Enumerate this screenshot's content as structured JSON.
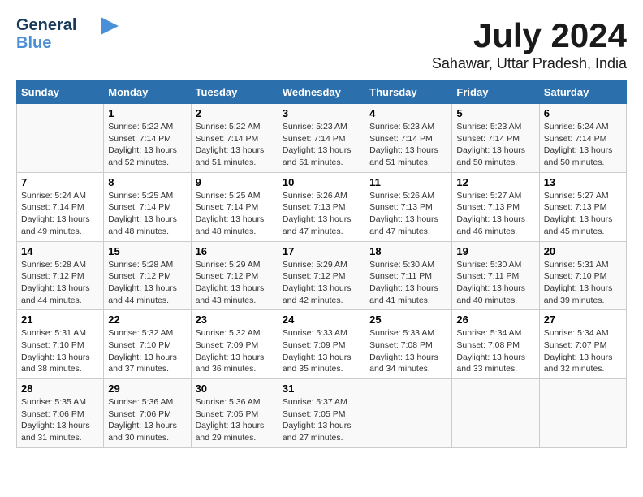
{
  "header": {
    "logo_line1": "General",
    "logo_line2": "Blue",
    "month": "July 2024",
    "location": "Sahawar, Uttar Pradesh, India"
  },
  "days_of_week": [
    "Sunday",
    "Monday",
    "Tuesday",
    "Wednesday",
    "Thursday",
    "Friday",
    "Saturday"
  ],
  "weeks": [
    [
      {
        "day": "",
        "sunrise": "",
        "sunset": "",
        "daylight": ""
      },
      {
        "day": "1",
        "sunrise": "Sunrise: 5:22 AM",
        "sunset": "Sunset: 7:14 PM",
        "daylight": "Daylight: 13 hours and 52 minutes."
      },
      {
        "day": "2",
        "sunrise": "Sunrise: 5:22 AM",
        "sunset": "Sunset: 7:14 PM",
        "daylight": "Daylight: 13 hours and 51 minutes."
      },
      {
        "day": "3",
        "sunrise": "Sunrise: 5:23 AM",
        "sunset": "Sunset: 7:14 PM",
        "daylight": "Daylight: 13 hours and 51 minutes."
      },
      {
        "day": "4",
        "sunrise": "Sunrise: 5:23 AM",
        "sunset": "Sunset: 7:14 PM",
        "daylight": "Daylight: 13 hours and 51 minutes."
      },
      {
        "day": "5",
        "sunrise": "Sunrise: 5:23 AM",
        "sunset": "Sunset: 7:14 PM",
        "daylight": "Daylight: 13 hours and 50 minutes."
      },
      {
        "day": "6",
        "sunrise": "Sunrise: 5:24 AM",
        "sunset": "Sunset: 7:14 PM",
        "daylight": "Daylight: 13 hours and 50 minutes."
      }
    ],
    [
      {
        "day": "7",
        "sunrise": "Sunrise: 5:24 AM",
        "sunset": "Sunset: 7:14 PM",
        "daylight": "Daylight: 13 hours and 49 minutes."
      },
      {
        "day": "8",
        "sunrise": "Sunrise: 5:25 AM",
        "sunset": "Sunset: 7:14 PM",
        "daylight": "Daylight: 13 hours and 48 minutes."
      },
      {
        "day": "9",
        "sunrise": "Sunrise: 5:25 AM",
        "sunset": "Sunset: 7:14 PM",
        "daylight": "Daylight: 13 hours and 48 minutes."
      },
      {
        "day": "10",
        "sunrise": "Sunrise: 5:26 AM",
        "sunset": "Sunset: 7:13 PM",
        "daylight": "Daylight: 13 hours and 47 minutes."
      },
      {
        "day": "11",
        "sunrise": "Sunrise: 5:26 AM",
        "sunset": "Sunset: 7:13 PM",
        "daylight": "Daylight: 13 hours and 47 minutes."
      },
      {
        "day": "12",
        "sunrise": "Sunrise: 5:27 AM",
        "sunset": "Sunset: 7:13 PM",
        "daylight": "Daylight: 13 hours and 46 minutes."
      },
      {
        "day": "13",
        "sunrise": "Sunrise: 5:27 AM",
        "sunset": "Sunset: 7:13 PM",
        "daylight": "Daylight: 13 hours and 45 minutes."
      }
    ],
    [
      {
        "day": "14",
        "sunrise": "Sunrise: 5:28 AM",
        "sunset": "Sunset: 7:12 PM",
        "daylight": "Daylight: 13 hours and 44 minutes."
      },
      {
        "day": "15",
        "sunrise": "Sunrise: 5:28 AM",
        "sunset": "Sunset: 7:12 PM",
        "daylight": "Daylight: 13 hours and 44 minutes."
      },
      {
        "day": "16",
        "sunrise": "Sunrise: 5:29 AM",
        "sunset": "Sunset: 7:12 PM",
        "daylight": "Daylight: 13 hours and 43 minutes."
      },
      {
        "day": "17",
        "sunrise": "Sunrise: 5:29 AM",
        "sunset": "Sunset: 7:12 PM",
        "daylight": "Daylight: 13 hours and 42 minutes."
      },
      {
        "day": "18",
        "sunrise": "Sunrise: 5:30 AM",
        "sunset": "Sunset: 7:11 PM",
        "daylight": "Daylight: 13 hours and 41 minutes."
      },
      {
        "day": "19",
        "sunrise": "Sunrise: 5:30 AM",
        "sunset": "Sunset: 7:11 PM",
        "daylight": "Daylight: 13 hours and 40 minutes."
      },
      {
        "day": "20",
        "sunrise": "Sunrise: 5:31 AM",
        "sunset": "Sunset: 7:10 PM",
        "daylight": "Daylight: 13 hours and 39 minutes."
      }
    ],
    [
      {
        "day": "21",
        "sunrise": "Sunrise: 5:31 AM",
        "sunset": "Sunset: 7:10 PM",
        "daylight": "Daylight: 13 hours and 38 minutes."
      },
      {
        "day": "22",
        "sunrise": "Sunrise: 5:32 AM",
        "sunset": "Sunset: 7:10 PM",
        "daylight": "Daylight: 13 hours and 37 minutes."
      },
      {
        "day": "23",
        "sunrise": "Sunrise: 5:32 AM",
        "sunset": "Sunset: 7:09 PM",
        "daylight": "Daylight: 13 hours and 36 minutes."
      },
      {
        "day": "24",
        "sunrise": "Sunrise: 5:33 AM",
        "sunset": "Sunset: 7:09 PM",
        "daylight": "Daylight: 13 hours and 35 minutes."
      },
      {
        "day": "25",
        "sunrise": "Sunrise: 5:33 AM",
        "sunset": "Sunset: 7:08 PM",
        "daylight": "Daylight: 13 hours and 34 minutes."
      },
      {
        "day": "26",
        "sunrise": "Sunrise: 5:34 AM",
        "sunset": "Sunset: 7:08 PM",
        "daylight": "Daylight: 13 hours and 33 minutes."
      },
      {
        "day": "27",
        "sunrise": "Sunrise: 5:34 AM",
        "sunset": "Sunset: 7:07 PM",
        "daylight": "Daylight: 13 hours and 32 minutes."
      }
    ],
    [
      {
        "day": "28",
        "sunrise": "Sunrise: 5:35 AM",
        "sunset": "Sunset: 7:06 PM",
        "daylight": "Daylight: 13 hours and 31 minutes."
      },
      {
        "day": "29",
        "sunrise": "Sunrise: 5:36 AM",
        "sunset": "Sunset: 7:06 PM",
        "daylight": "Daylight: 13 hours and 30 minutes."
      },
      {
        "day": "30",
        "sunrise": "Sunrise: 5:36 AM",
        "sunset": "Sunset: 7:05 PM",
        "daylight": "Daylight: 13 hours and 29 minutes."
      },
      {
        "day": "31",
        "sunrise": "Sunrise: 5:37 AM",
        "sunset": "Sunset: 7:05 PM",
        "daylight": "Daylight: 13 hours and 27 minutes."
      },
      {
        "day": "",
        "sunrise": "",
        "sunset": "",
        "daylight": ""
      },
      {
        "day": "",
        "sunrise": "",
        "sunset": "",
        "daylight": ""
      },
      {
        "day": "",
        "sunrise": "",
        "sunset": "",
        "daylight": ""
      }
    ]
  ]
}
